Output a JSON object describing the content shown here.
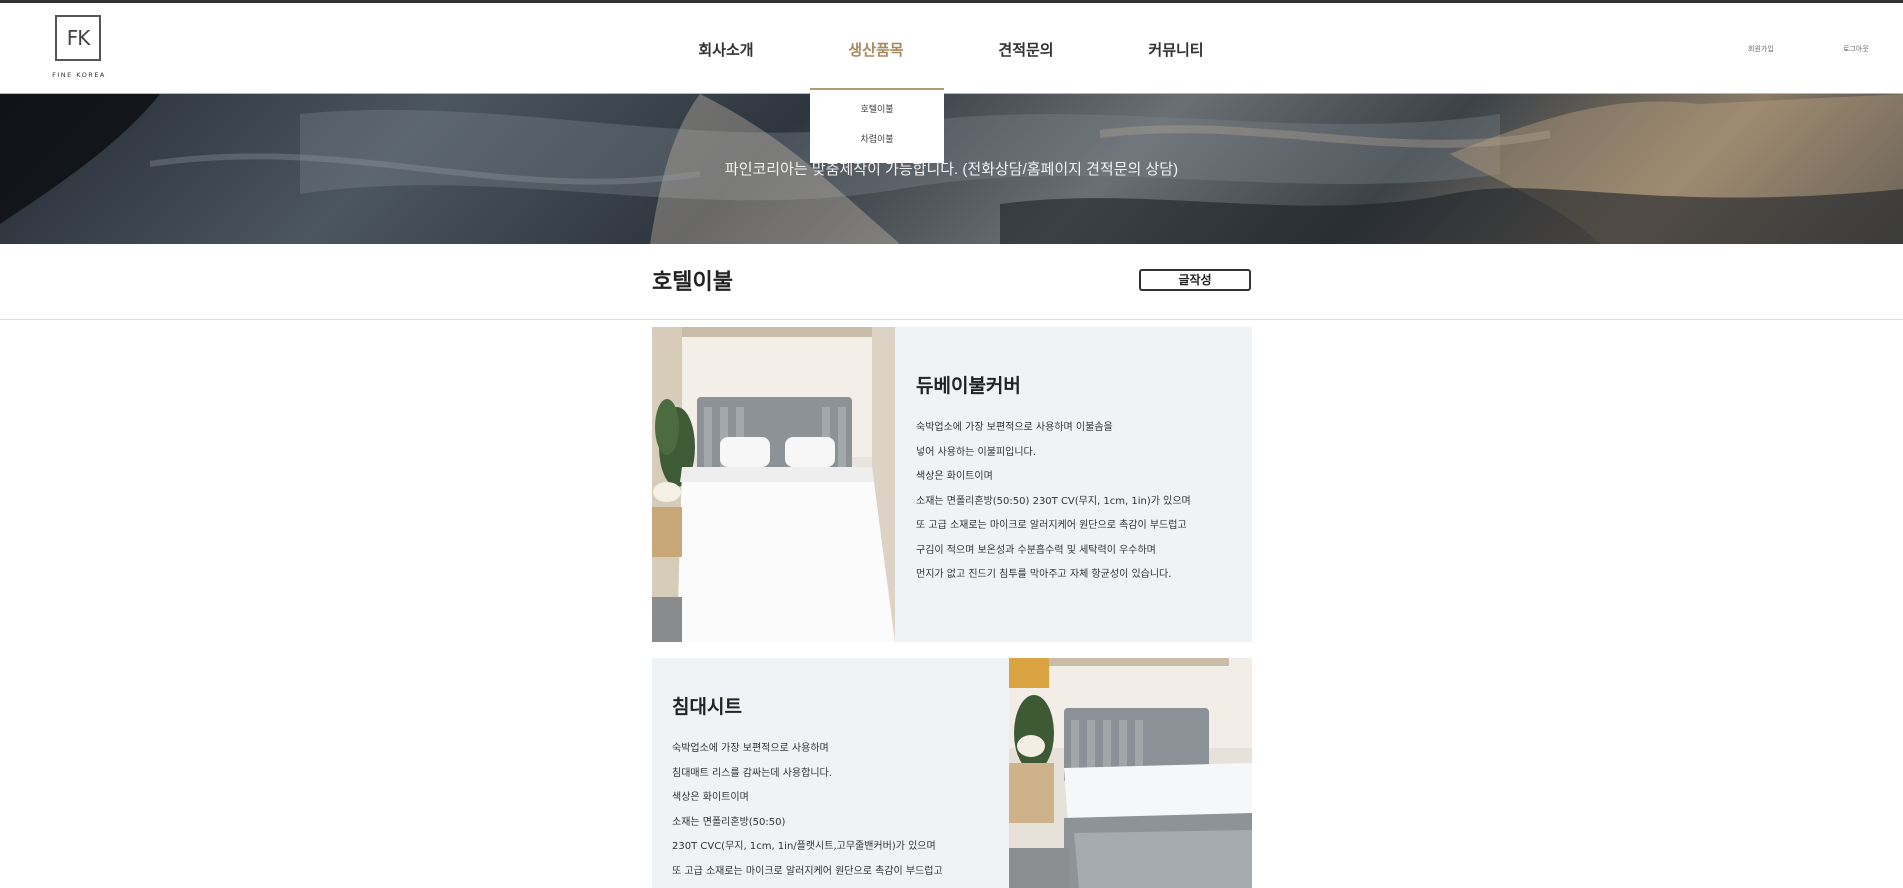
{
  "logo": {
    "mark": "FK",
    "sub": "FINE KOREA"
  },
  "nav": {
    "items": [
      {
        "label": "회사소개"
      },
      {
        "label": "생산품목"
      },
      {
        "label": "견적문의"
      },
      {
        "label": "커뮤니티"
      }
    ],
    "dropdown": [
      "호텔이불",
      "차렵이불"
    ]
  },
  "util": {
    "signup": "회원가입",
    "login": "로그아웃"
  },
  "banner": {
    "text": "파인코리아는 맞춤제작이 가능합니다. (전화상담/홈페이지 견적문의 상담)"
  },
  "page": {
    "title": "호텔이불",
    "write_label": "글작성"
  },
  "products": [
    {
      "title": "듀베이불커버",
      "lines": [
        "숙박업소에 가장 보편적으로 사용하며 이불솜을",
        "넣어 사용하는 이불피입니다.",
        "색상은 화이트이며",
        "소재는 면폴리혼방(50:50) 230T CV(무지, 1cm, 1in)가 있으며",
        "또 고급 소재로는 마이크로 알러지케어 원단으로 촉감이 부드럽고",
        "구김이 적으며 보온성과 수분흡수력 및 세탁력이 우수하며",
        "먼지가 없고 진드기 침투를 막아주고 자체 항균성이 있습니다."
      ]
    },
    {
      "title": "침대시트",
      "lines": [
        "숙박업소에 가장 보편적으로 사용하며",
        "침대매트 리스를 감싸는데 사용합니다.",
        "색상은 화이트이며",
        "소재는 면폴리혼방(50:50)",
        "230T CVC(무지, 1cm, 1in/플랫시트,고무줄밴커버)가 있으며",
        "또 고급 소재로는 마이크로 알러지케어 원단으로 촉감이 부드럽고"
      ]
    }
  ]
}
